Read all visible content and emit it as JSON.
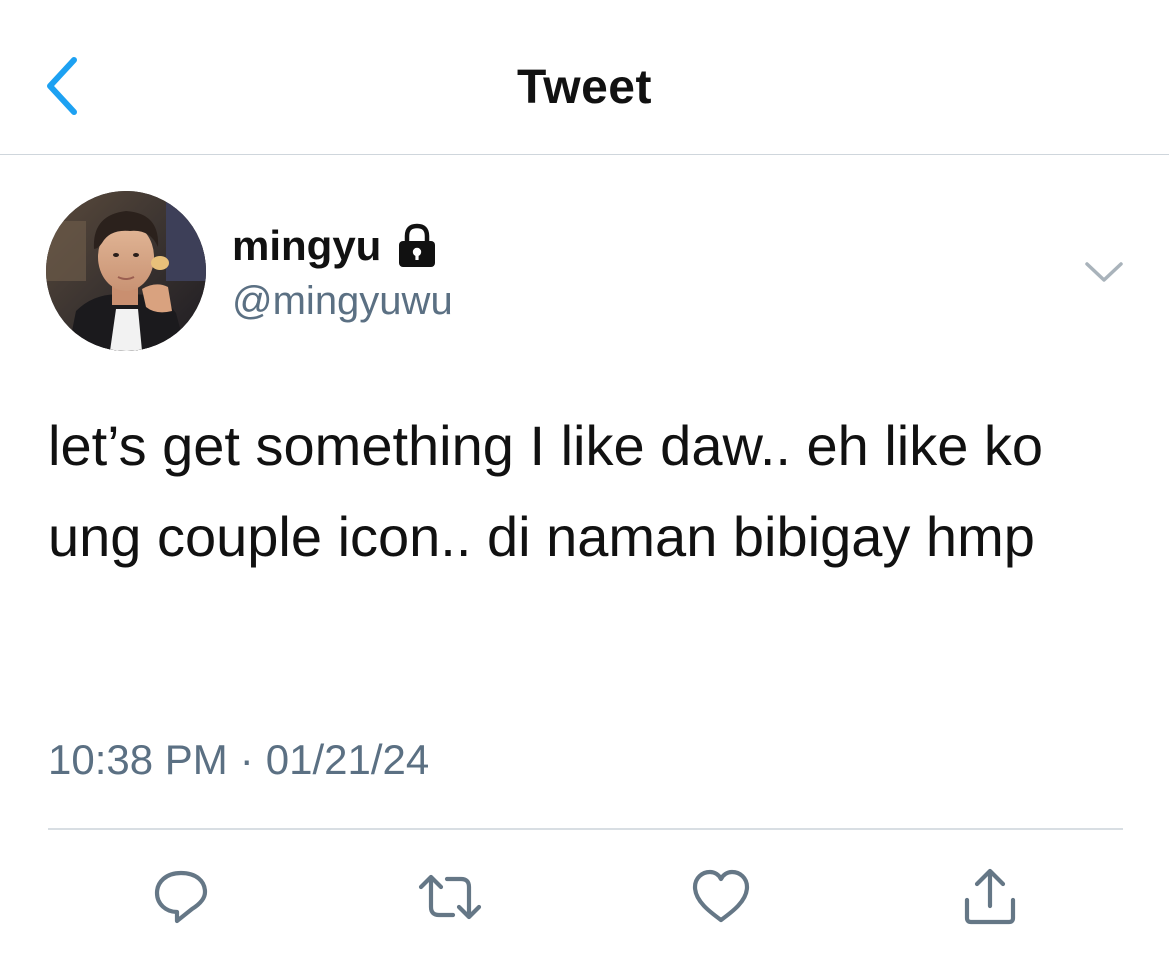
{
  "header": {
    "title": "Tweet",
    "back_icon": "chevron-left-icon",
    "accent_color": "#1da1f2"
  },
  "tweet": {
    "author": {
      "display_name": "mingyu",
      "handle": "@mingyuwu",
      "protected_icon": "lock-icon"
    },
    "text": "let’s get something I like daw.. eh like ko ung couple icon.. di naman bibigay hmp",
    "time": "10:38 PM",
    "separator": "·",
    "date": "01/21/24",
    "more_icon": "chevron-down-icon"
  },
  "actions": [
    {
      "name": "reply",
      "icon": "reply-icon"
    },
    {
      "name": "retweet",
      "icon": "retweet-icon"
    },
    {
      "name": "like",
      "icon": "heart-icon"
    },
    {
      "name": "share",
      "icon": "share-icon"
    }
  ],
  "colors": {
    "text": "#111111",
    "secondary_text": "#5b7083",
    "icon_gray": "#657786",
    "divider": "#d8dee3"
  }
}
